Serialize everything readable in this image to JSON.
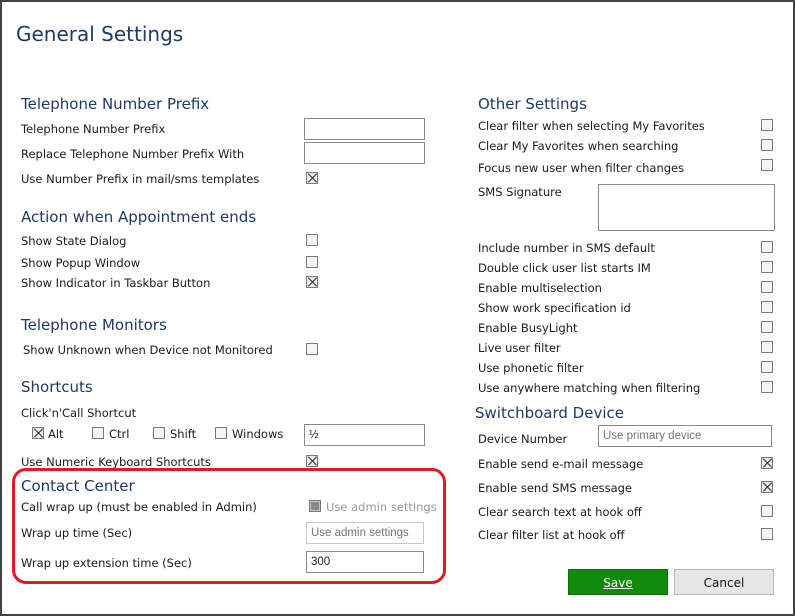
{
  "window": {
    "title": "General Settings"
  },
  "left": {
    "telephone_prefix": {
      "heading": "Telephone Number Prefix",
      "prefix_label": "Telephone Number Prefix",
      "prefix_value": "",
      "replace_label": "Replace Telephone Number Prefix With",
      "replace_value": "",
      "use_prefix_label": "Use Number Prefix in mail/sms templates",
      "use_prefix_checked": true
    },
    "appointment": {
      "heading": "Action when Appointment ends",
      "show_state_label": "Show State Dialog",
      "show_popup_label": "Show Popup Window",
      "show_indicator_label": "Show Indicator in Taskbar Button"
    },
    "monitors": {
      "heading": "Telephone Monitors",
      "show_unknown_label": "Show Unknown when Device not Monitored"
    },
    "shortcuts": {
      "heading": "Shortcuts",
      "clickncall_label": "Click'n'Call Shortcut",
      "alt_label": "Alt",
      "ctrl_label": "Ctrl",
      "shift_label": "Shift",
      "windows_label": "Windows",
      "key_value": "½",
      "numeric_label": "Use Numeric Keyboard Shortcuts"
    },
    "contact_center": {
      "heading": "Contact Center",
      "wrap_label": "Call wrap up (must be enabled in Admin)",
      "wrap_admin_label": "Use admin settings",
      "wrap_time_label": "Wrap up time (Sec)",
      "wrap_time_placeholder": "Use admin settings",
      "wrap_ext_label": "Wrap up extension time (Sec)",
      "wrap_ext_value": "300"
    }
  },
  "right": {
    "other": {
      "heading": "Other Settings",
      "clear_filter_fav_label": "Clear filter when selecting My Favorites",
      "clear_fav_search_label": "Clear My Favorites when searching",
      "focus_new_user_label": "Focus new user when filter changes",
      "sms_signature_label": "SMS Signature",
      "sms_signature_value": "",
      "include_number_label": "Include number in SMS default",
      "double_click_label": "Double click user list starts IM",
      "multiselection_label": "Enable  multiselection",
      "work_spec_label": "Show work specification id",
      "busylight_label": "Enable BusyLight",
      "live_filter_label": "Live user filter",
      "phonetic_label": "Use phonetic filter",
      "anywhere_label": "Use anywhere matching when filtering"
    },
    "switchboard": {
      "heading": "Switchboard Device",
      "device_number_label": "Device Number",
      "device_number_placeholder": "Use primary device",
      "send_email_label": "Enable send e-mail message",
      "send_sms_label": "Enable send SMS message",
      "clear_search_label": "Clear search text at hook off",
      "clear_filter_label": "Clear filter list at hook off"
    }
  },
  "buttons": {
    "save": "Save",
    "cancel": "Cancel"
  },
  "colors": {
    "heading": "#1f3b63",
    "save_bg": "#118a0e",
    "highlight": "#e11a24"
  }
}
